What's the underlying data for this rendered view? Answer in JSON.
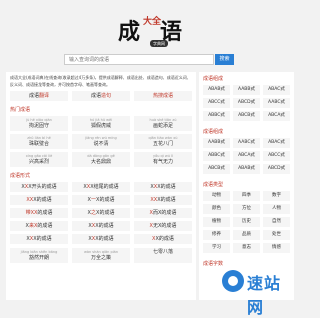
{
  "logo": {
    "char1": "成",
    "char_small": "大全",
    "char2": "语",
    "sub": "字典网"
  },
  "search": {
    "placeholder": "输入查询词的成语",
    "button": "搜索"
  },
  "intro": {
    "text": "成语大全(成语词典)在线查询(收录超过4万多条)，提供成语解释、成语出处、成语造句、成语近义词、反义词、成语接龙等查询，并可按首字母、笔画等查询。",
    "links": [
      [
        "成语",
        "翻译"
      ],
      [
        "成语",
        "造句"
      ],
      [
        "",
        "热搜成语"
      ]
    ]
  },
  "hot": {
    "title": "热门成语",
    "items": [
      {
        "py": "jù hé xiǎo qián",
        "w": "拘泥固守"
      },
      {
        "py": "hú jiǎ hǔ wēi",
        "w": "狐假虎威"
      },
      {
        "py": "huà shé tiān zú",
        "w": "画蛇添足"
      },
      {
        "py": "zhū lián bì hé",
        "w": "珠联璧合"
      },
      {
        "py": "jiǎng rèn wú míng",
        "w": "说不清"
      },
      {
        "py": "qiān tiáo wàn xù",
        "w": "五花八门"
      },
      {
        "py": "xìng gāo cǎi liè",
        "w": "兴高采烈"
      },
      {
        "py": "dà dòng gān gē",
        "w": "大名鼎鼎"
      },
      {
        "py": "yǒu qì wú lì",
        "w": "有气无力"
      },
      {
        "py": "tǎng yú liè shì",
        "w": "趟罗罗亭"
      }
    ]
  },
  "forms": {
    "title": "成语形式",
    "items": [
      [
        "X",
        "X",
        "X",
        "开头的成语"
      ],
      [
        "X",
        "X",
        "X",
        "结尾的成语"
      ],
      [
        "X",
        "X",
        "X",
        "的成语"
      ],
      [
        "",
        "XX",
        "X",
        "的成语"
      ],
      [
        "X",
        "一",
        "X",
        "的成语"
      ],
      [
        "",
        "XX",
        "X",
        "的成语"
      ],
      [
        "",
        "带XX",
        "",
        "的成语"
      ],
      [
        "X",
        "之",
        "X",
        "的成语"
      ],
      [
        "",
        "X",
        "而",
        "X的成语"
      ],
      [
        "X",
        "来X",
        "",
        "的成语"
      ],
      [
        "X",
        "X",
        "X",
        "的成语"
      ],
      [
        "",
        "X",
        "无",
        "X的成语"
      ],
      [
        "X",
        "X",
        "X",
        "的成语"
      ],
      [
        "X",
        "X",
        "X",
        "的成语"
      ],
      [
        "",
        "X",
        "X",
        "的成语"
      ]
    ]
  },
  "bottom": {
    "items": [
      {
        "py": "jiāng biān shěn bǎng",
        "w": "豁然开朗"
      },
      {
        "py": "wàn shàn qiān pián",
        "w": "万全之策"
      },
      {
        "py": "",
        "w": "七零八落"
      }
    ]
  },
  "right": {
    "t1": "成语组成",
    "g1": [
      "ABAB式",
      "AABB式",
      "ABAC式",
      "ABCC式",
      "ABCD式",
      "AABC式",
      "ABBC式",
      "ABCB式",
      "ABCA式"
    ],
    "t2": "成语组成",
    "g2": [
      "AABB式",
      "AABC式",
      "ABAC式",
      "ABBC式",
      "ABCA式",
      "ABCC式",
      "ABCB式",
      "ABAB式",
      "ABCD式"
    ],
    "t3": "成语类型",
    "g3": [
      "动物",
      "四季",
      "数字",
      "颜色",
      "方位",
      "人物",
      "植物",
      "历史",
      "自然",
      "修养",
      "品质",
      "处世",
      "学习",
      "意志",
      "情感"
    ],
    "t4": "成语字数"
  },
  "watermark": {
    "text": "速站网"
  },
  "colors": {
    "accent": "#c0392b",
    "brand": "#2a7fd4"
  }
}
